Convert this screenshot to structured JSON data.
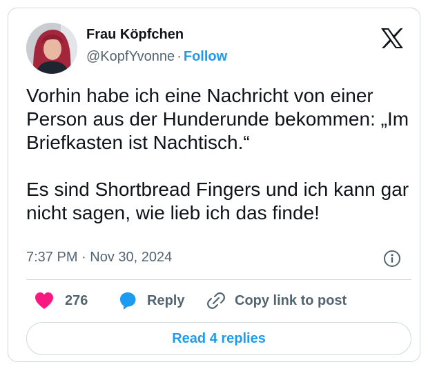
{
  "author": {
    "display_name": "Frau Köpfchen",
    "handle": "@KopfYvonne",
    "separator": "·",
    "follow_label": "Follow"
  },
  "tweet": {
    "paragraph_1": "Vorhin habe ich eine Nachricht von einer Person aus der Hunderunde bekommen: „Im Briefkasten ist Nachtisch.“",
    "paragraph_2": "Es sind Shortbread Fingers und ich kann gar nicht sagen, wie lieb ich das finde!",
    "timestamp": "7:37 PM · Nov 30, 2024"
  },
  "actions": {
    "like_count": "276",
    "reply_label": "Reply",
    "copy_label": "Copy link to post"
  },
  "read_replies_label": "Read 4 replies",
  "icons": {
    "like": "heart-icon",
    "reply": "speech-bubble-icon",
    "copy": "link-icon",
    "info": "info-icon",
    "logo": "x-logo-icon"
  },
  "colors": {
    "accent": "#1d9bf0",
    "like": "#f91880",
    "muted": "#536471",
    "border": "#cfd9de",
    "text": "#0f1419"
  }
}
